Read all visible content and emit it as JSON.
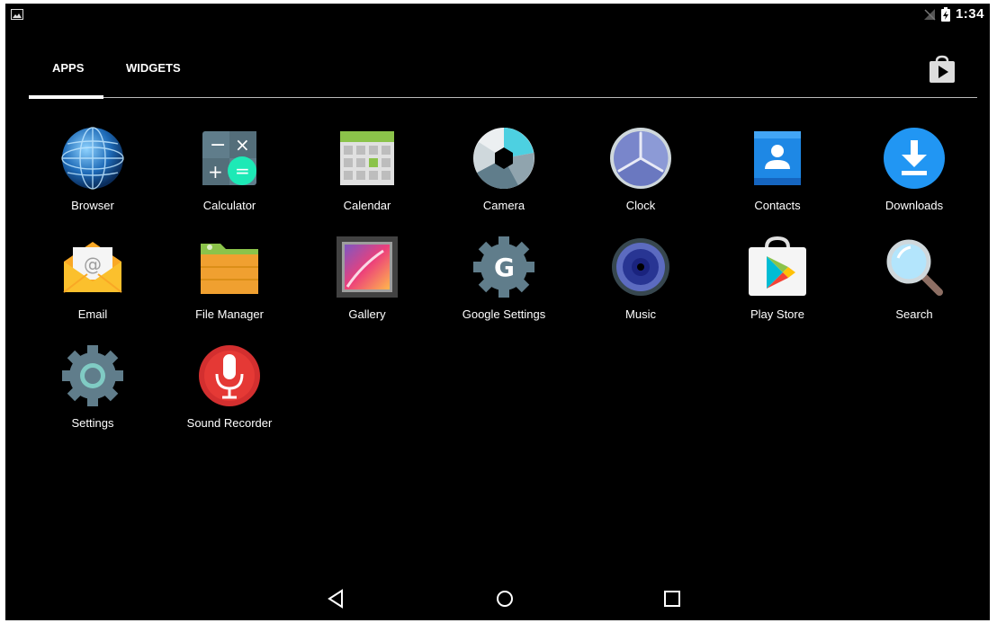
{
  "status": {
    "time": "1:34"
  },
  "tabs": [
    {
      "label": "APPS",
      "active": true
    },
    {
      "label": "WIDGETS",
      "active": false
    }
  ],
  "apps": [
    {
      "label": "Browser",
      "icon": "browser-globe-icon"
    },
    {
      "label": "Calculator",
      "icon": "calculator-icon"
    },
    {
      "label": "Calendar",
      "icon": "calendar-icon"
    },
    {
      "label": "Camera",
      "icon": "camera-aperture-icon"
    },
    {
      "label": "Clock",
      "icon": "clock-icon"
    },
    {
      "label": "Contacts",
      "icon": "contacts-icon"
    },
    {
      "label": "Downloads",
      "icon": "download-icon"
    },
    {
      "label": "Email",
      "icon": "email-envelope-icon"
    },
    {
      "label": "File Manager",
      "icon": "folder-icon"
    },
    {
      "label": "Gallery",
      "icon": "gallery-picture-icon"
    },
    {
      "label": "Google Settings",
      "icon": "google-settings-gear-icon"
    },
    {
      "label": "Music",
      "icon": "music-speaker-icon"
    },
    {
      "label": "Play Store",
      "icon": "play-store-bag-icon"
    },
    {
      "label": "Search",
      "icon": "magnifier-icon"
    },
    {
      "label": "Settings",
      "icon": "settings-gear-icon"
    },
    {
      "label": "Sound Recorder",
      "icon": "microphone-icon"
    }
  ],
  "colors": {
    "background": "#000000",
    "downloads": "#2196f3",
    "contacts": "#1e88e5",
    "calculator_accent": "#1de9b6",
    "sound_recorder": "#d32f2f"
  }
}
